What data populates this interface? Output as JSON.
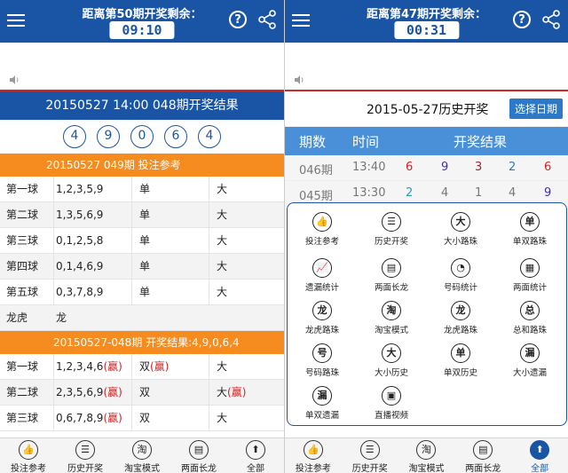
{
  "left": {
    "title": "距离第50期开奖剩余：",
    "timer": "09:10",
    "result_header": "20150527  14:00  048期开奖结果",
    "balls": [
      "4",
      "9",
      "0",
      "6",
      "4"
    ],
    "ref_header": "20150527   049期  投注参考",
    "ref_rows": [
      {
        "name": "第一球",
        "nums": "1,2,3,5,9",
        "oe": "单",
        "size": "大"
      },
      {
        "name": "第二球",
        "nums": "1,3,5,6,9",
        "oe": "单",
        "size": "大"
      },
      {
        "name": "第三球",
        "nums": "0,1,2,5,8",
        "oe": "单",
        "size": "大"
      },
      {
        "name": "第四球",
        "nums": "0,1,4,6,9",
        "oe": "单",
        "size": "大"
      },
      {
        "name": "第五球",
        "nums": "0,3,7,8,9",
        "oe": "单",
        "size": "大"
      },
      {
        "name": "龙虎",
        "nums": "龙",
        "oe": "",
        "size": ""
      }
    ],
    "res_header": "20150527-048期 开奖结果:4,9,0,6,4",
    "res_rows": [
      {
        "name": "第一球",
        "nums": "1,2,3,4,6",
        "nums_win": "(赢)",
        "oe": "双",
        "oe_win": "(赢)",
        "size": "大",
        "size_win": ""
      },
      {
        "name": "第二球",
        "nums": "2,3,5,6,9",
        "nums_win": "(赢)",
        "oe": "双",
        "oe_win": "",
        "size": "大",
        "size_win": "(赢)"
      },
      {
        "name": "第三球",
        "nums": "0,6,7,8,9",
        "nums_win": "(赢)",
        "oe": "双",
        "oe_win": "",
        "size": "大",
        "size_win": ""
      }
    ],
    "nav": [
      "投注参考",
      "历史开奖",
      "淘宝模式",
      "两面长龙",
      "全部"
    ]
  },
  "right": {
    "title": "距离第47期开奖剩余：",
    "timer": "00:31",
    "hist_title": "2015-05-27历史开奖",
    "date_button": "选择日期",
    "col_period": "期数",
    "col_time": "时间",
    "col_result": "开奖结果",
    "rows": [
      {
        "period": "046期",
        "time": "13:40",
        "n": [
          "6",
          "9",
          "3",
          "2",
          "6"
        ]
      },
      {
        "period": "045期",
        "time": "13:30",
        "n": [
          "2",
          "4",
          "1",
          "4",
          "9"
        ]
      }
    ],
    "menu": [
      {
        "label": "投注参考",
        "icon": "thumb-icon",
        "glyph": "👍"
      },
      {
        "label": "历史开奖",
        "icon": "list-icon",
        "glyph": "☰"
      },
      {
        "label": "大小路珠",
        "icon": "big-icon",
        "glyph": "大"
      },
      {
        "label": "单双路珠",
        "icon": "single-icon",
        "glyph": "单"
      },
      {
        "label": "遗漏统计",
        "icon": "chart-icon",
        "glyph": "📈"
      },
      {
        "label": "两面长龙",
        "icon": "doc-icon",
        "glyph": "▤"
      },
      {
        "label": "号码统计",
        "icon": "pie-icon",
        "glyph": "◔"
      },
      {
        "label": "两面统计",
        "icon": "table-icon",
        "glyph": "▦"
      },
      {
        "label": "龙虎路珠",
        "icon": "dragon-icon",
        "glyph": "龙"
      },
      {
        "label": "淘宝模式",
        "icon": "taobao-icon",
        "glyph": "淘"
      },
      {
        "label": "龙虎路珠",
        "icon": "dragon-icon",
        "glyph": "龙"
      },
      {
        "label": "总和路珠",
        "icon": "total-icon",
        "glyph": "总"
      },
      {
        "label": "号码路珠",
        "icon": "number-icon",
        "glyph": "号"
      },
      {
        "label": "大小历史",
        "icon": "big-icon",
        "glyph": "大"
      },
      {
        "label": "单双历史",
        "icon": "single-icon",
        "glyph": "单"
      },
      {
        "label": "大小遗漏",
        "icon": "miss-icon",
        "glyph": "漏"
      },
      {
        "label": "单双遗漏",
        "icon": "miss-icon",
        "glyph": "漏"
      },
      {
        "label": "直播视频",
        "icon": "video-icon",
        "glyph": "▣"
      }
    ],
    "nav": [
      "投注参考",
      "历史开奖",
      "淘宝模式",
      "两面长龙",
      "全部"
    ]
  },
  "colors": {
    "blue": "#1a55a5",
    "orange": "#f68b1f",
    "red": "#d62020"
  }
}
